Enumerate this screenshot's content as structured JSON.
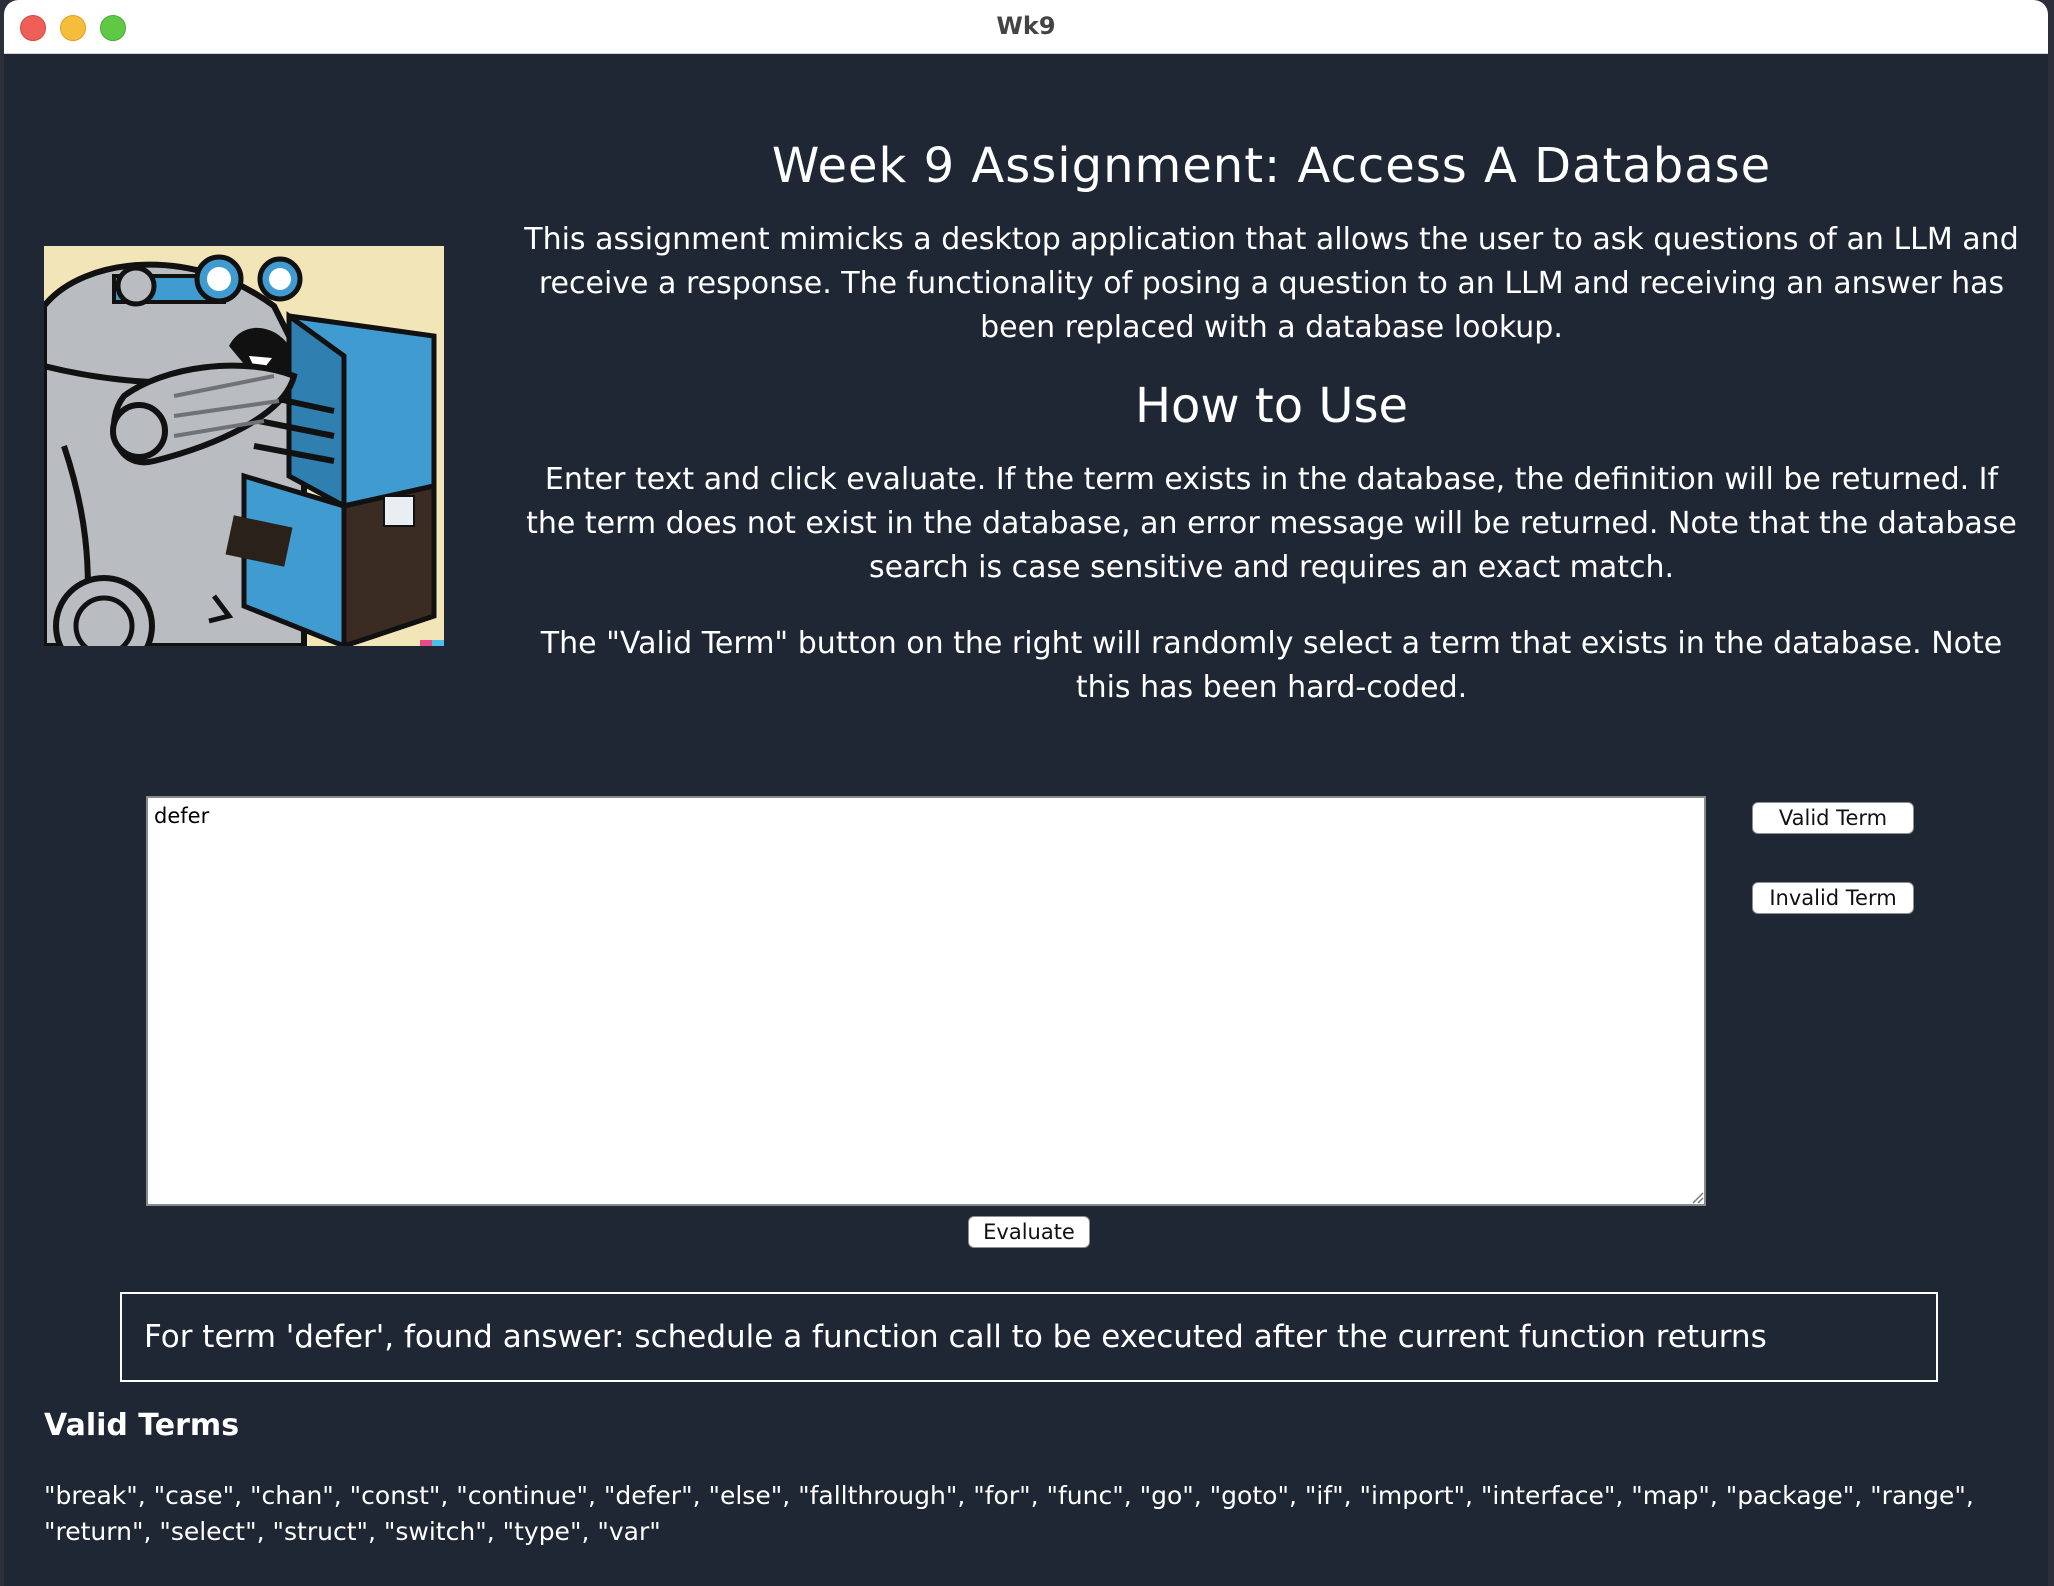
{
  "window": {
    "title": "Wk9"
  },
  "header": {
    "title": "Week 9 Assignment: Access A Database",
    "description": "This assignment mimicks a desktop application that allows the user to ask questions of an LLM and receive a response. The functionality of posing a question to an LLM and receiving an answer has been replaced with a database lookup."
  },
  "how_to": {
    "title": "How to Use",
    "instructions": "Enter text and click evaluate. If the term exists in the database, the definition will be returned. If the term does not exist in the database, an error message will be returned. Note that the database search is case sensitive and requires an exact match.",
    "valid_note": "The \"Valid Term\" button on the right will randomly select a term that exists in the database. Note this has been hard-coded."
  },
  "query": {
    "value": "defer"
  },
  "buttons": {
    "valid_term": "Valid Term",
    "invalid_term": "Invalid Term",
    "evaluate": "Evaluate"
  },
  "result": {
    "text": "For term 'defer', found answer: schedule a function call to be executed after the current function returns"
  },
  "valid_terms": {
    "heading": "Valid Terms",
    "list": "\"break\", \"case\", \"chan\", \"const\", \"continue\", \"defer\", \"else\", \"fallthrough\", \"for\", \"func\", \"go\", \"goto\", \"if\", \"import\", \"interface\", \"map\", \"package\", \"range\", \"return\", \"select\", \"struct\", \"switch\", \"type\", \"var\""
  },
  "colors": {
    "background": "#1f2634",
    "text": "#ffffff",
    "logo_background": "#f2e6b8",
    "logo_blue": "#3f9bd0"
  }
}
